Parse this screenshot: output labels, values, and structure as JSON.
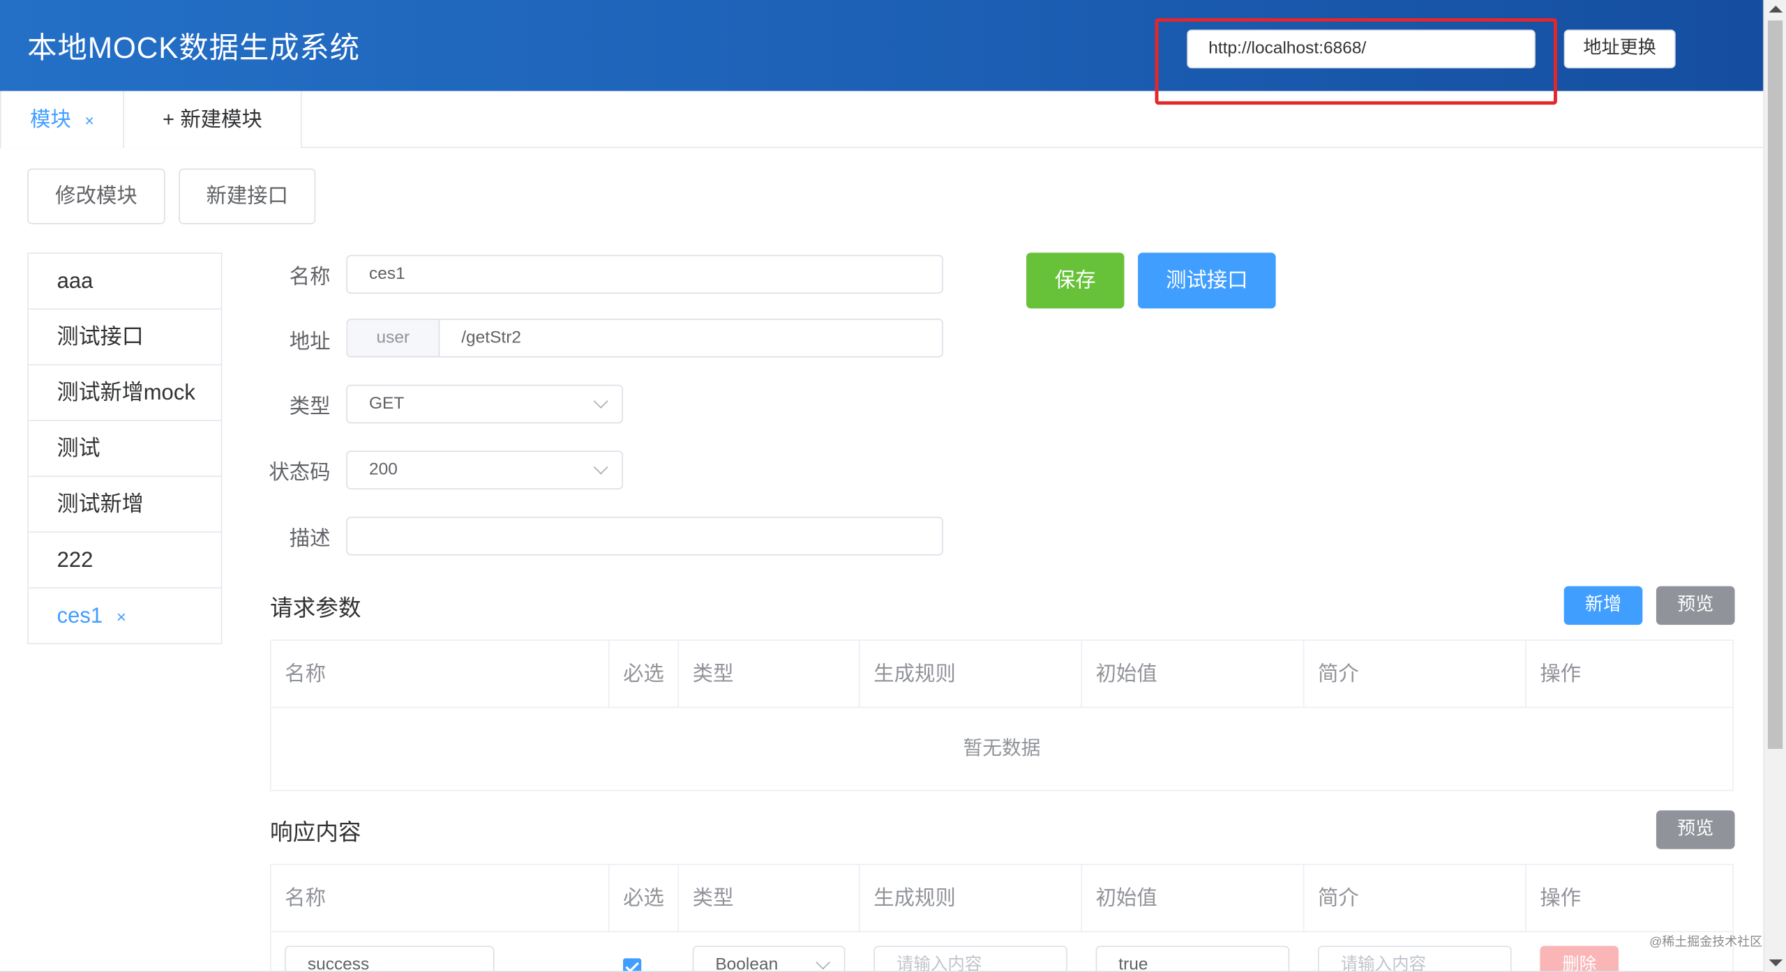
{
  "header": {
    "title": "本地MOCK数据生成系统",
    "url_value": "http://localhost:6868/",
    "switch_button": "地址更换",
    "highlight_color": "#e5262a"
  },
  "tabs": {
    "active_label": "模块",
    "close_glyph": "×",
    "new_label": "+ 新建模块"
  },
  "toolbar": {
    "edit_module": "修改模块",
    "new_api": "新建接口"
  },
  "sidebar": {
    "items": [
      {
        "label": "aaa"
      },
      {
        "label": "测试接口"
      },
      {
        "label": "测试新增mock"
      },
      {
        "label": "测试"
      },
      {
        "label": "测试新增"
      },
      {
        "label": "222"
      },
      {
        "label": "ces1",
        "close": "×"
      }
    ]
  },
  "form": {
    "name_label": "名称",
    "name_value": "ces1",
    "addr_label": "地址",
    "addr_prefix": "user",
    "addr_value": "/getStr2",
    "type_label": "类型",
    "type_value": "GET",
    "status_label": "状态码",
    "status_value": "200",
    "desc_label": "描述",
    "desc_value": "",
    "save_button": "保存",
    "test_button": "测试接口"
  },
  "request": {
    "title": "请求参数",
    "add_button": "新增",
    "preview_button": "预览",
    "columns": [
      "名称",
      "必选",
      "类型",
      "生成规则",
      "初始值",
      "简介",
      "操作"
    ],
    "empty_text": "暂无数据"
  },
  "response": {
    "title": "响应内容",
    "preview_button": "预览",
    "columns": [
      "名称",
      "必选",
      "类型",
      "生成规则",
      "初始值",
      "简介",
      "操作"
    ],
    "rows": [
      {
        "name": "success",
        "required": true,
        "type": "Boolean",
        "rule_placeholder": "请输入内容",
        "initial": "true",
        "intro_placeholder": "请输入内容",
        "delete_label": "删除"
      }
    ]
  },
  "watermark": "@稀土掘金技术社区",
  "colors": {
    "primary": "#409eff",
    "success": "#67c23a",
    "info": "#909399",
    "danger_light": "#fab6b6",
    "header_start": "#2470c7",
    "header_end": "#154ea0"
  }
}
